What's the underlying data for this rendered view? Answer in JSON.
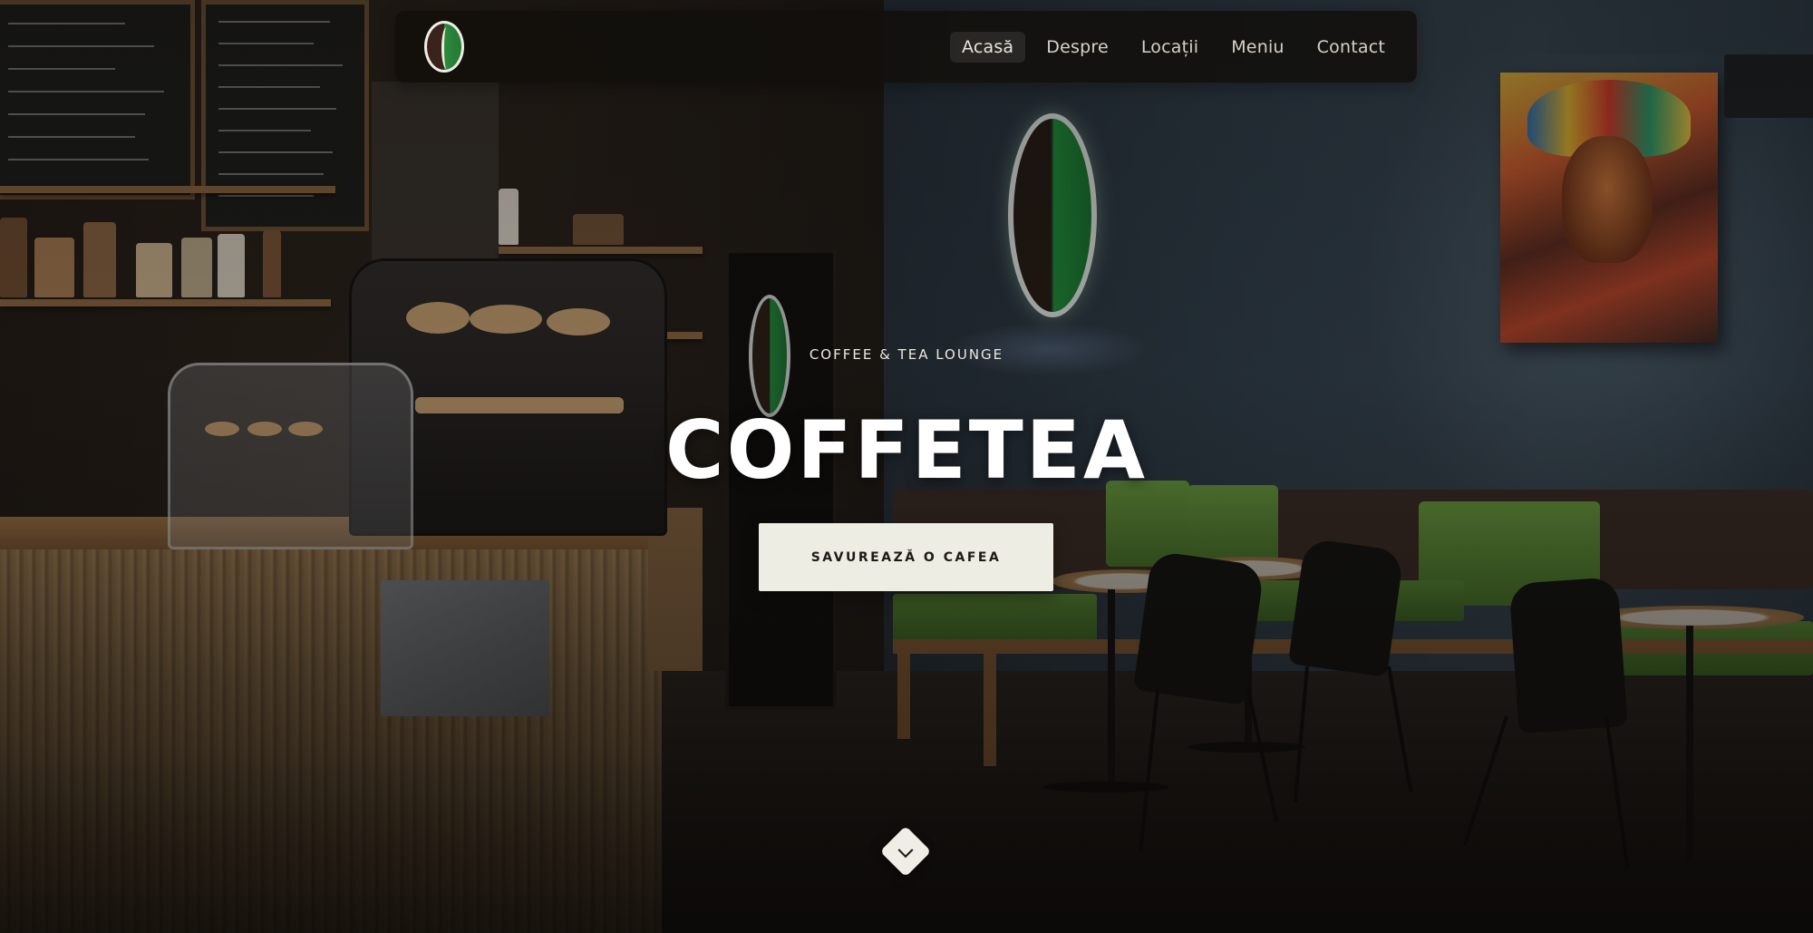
{
  "brand": {
    "logo_icon": "coffee-bean-logo-icon",
    "colors": {
      "bean_dark": "#3a231a",
      "bean_green": "#2c8a3e",
      "outline": "#efece4"
    }
  },
  "nav": {
    "items": [
      {
        "label": "Acasă",
        "active": true
      },
      {
        "label": "Despre",
        "active": false
      },
      {
        "label": "Locații",
        "active": false
      },
      {
        "label": "Meniu",
        "active": false
      },
      {
        "label": "Contact",
        "active": false
      }
    ]
  },
  "hero": {
    "eyebrow": "COFFEE & TEA LOUNGE",
    "title": "COFFETEA",
    "cta_label": "SAVUREAZĂ O CAFEA",
    "scroll_icon": "chevron-down-icon",
    "colors": {
      "cta_bg": "#eeede3",
      "cta_text": "#1d1a16",
      "title": "#ffffff"
    }
  }
}
